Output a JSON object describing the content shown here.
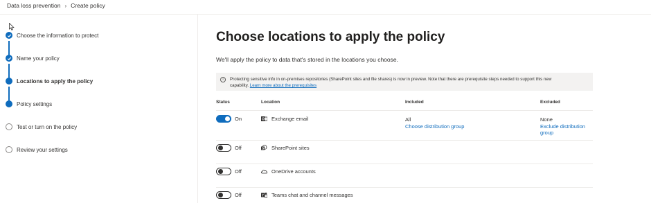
{
  "breadcrumb": {
    "root": "Data loss prevention",
    "current": "Create policy"
  },
  "steps": [
    {
      "label": "Choose the information to protect",
      "state": "done"
    },
    {
      "label": "Name your policy",
      "state": "done"
    },
    {
      "label": "Locations to apply the policy",
      "state": "current"
    },
    {
      "label": "Policy settings",
      "state": "done"
    },
    {
      "label": "Test or turn on the policy",
      "state": "todo"
    },
    {
      "label": "Review your settings",
      "state": "todo"
    }
  ],
  "main": {
    "title": "Choose locations to apply the policy",
    "subtitle": "We'll apply the policy to data that's stored in the locations you choose.",
    "banner": {
      "text_line1": "Protecting sensitive info in on-premises repositories (SharePoint sites and file shares) is now in preview. Note that there are prerequisite steps needed to support this new",
      "text_line2": "capability.",
      "link": "Learn more about the prerequisites"
    },
    "columns": {
      "status": "Status",
      "location": "Location",
      "included": "Included",
      "excluded": "Excluded"
    },
    "rows": [
      {
        "status": "On",
        "location": "Exchange email",
        "icon": "outlook-icon",
        "included": "All",
        "included_link": "Choose distribution group",
        "excluded": "None",
        "excluded_link": "Exclude distribution group"
      },
      {
        "status": "Off",
        "location": "SharePoint sites",
        "icon": "sharepoint-icon"
      },
      {
        "status": "Off",
        "location": "OneDrive accounts",
        "icon": "onedrive-icon"
      },
      {
        "status": "Off",
        "location": "Teams chat and channel messages",
        "icon": "teams-icon"
      }
    ]
  },
  "colors": {
    "accent": "#0f6cbd",
    "text": "#323130",
    "banner_bg": "#f3f2f1"
  }
}
